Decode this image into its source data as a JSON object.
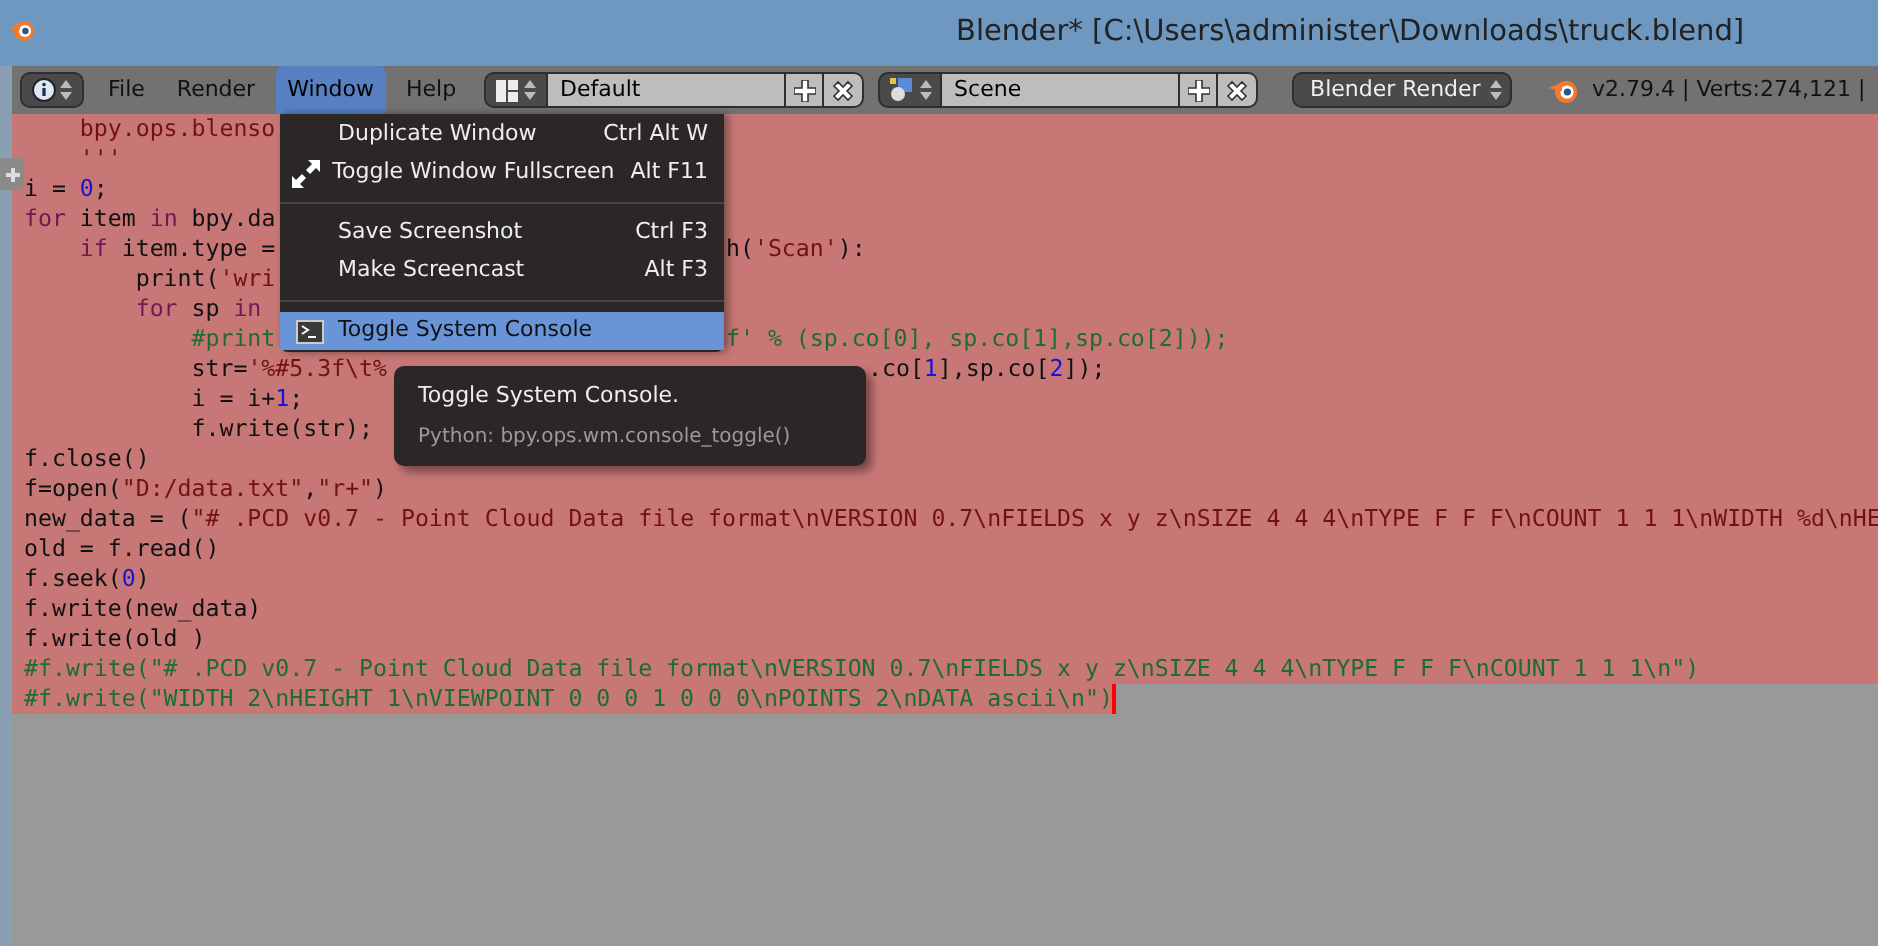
{
  "window": {
    "title": "Blender* [C:\\Users\\administer\\Downloads\\truck.blend]"
  },
  "header": {
    "menus": [
      {
        "label": "File",
        "selected": false
      },
      {
        "label": "Render",
        "selected": false
      },
      {
        "label": "Window",
        "selected": true
      },
      {
        "label": "Help",
        "selected": false
      }
    ],
    "screen_layout": {
      "value": "Default"
    },
    "scene": {
      "value": "Scene"
    },
    "render_engine": {
      "value": "Blender Render"
    },
    "stats": "v2.79.4 | Verts:274,121 |"
  },
  "window_menu": {
    "items": [
      {
        "kind": "item",
        "label": "Duplicate Window",
        "shortcut": "Ctrl Alt W",
        "highlighted": false
      },
      {
        "kind": "fullscreen",
        "label": "Toggle Window Fullscreen",
        "shortcut": "Alt F11",
        "highlighted": false
      },
      {
        "kind": "separator"
      },
      {
        "kind": "item",
        "label": "Save Screenshot",
        "shortcut": "Ctrl F3",
        "highlighted": false
      },
      {
        "kind": "item",
        "label": "Make Screencast",
        "shortcut": "Alt F3",
        "highlighted": false
      },
      {
        "kind": "separator"
      },
      {
        "kind": "console",
        "label": "Toggle System Console",
        "highlighted": true
      }
    ]
  },
  "tooltip": {
    "title": "Toggle System Console.",
    "python": "Python: bpy.ops.wm.console_toggle()"
  },
  "editor": {
    "cursor": true,
    "lines": [
      {
        "tokens": [
          {
            "kind": "string",
            "text": "    bpy.ops.blenso"
          }
        ]
      },
      {
        "tokens": [
          {
            "kind": "string",
            "text": "    '''"
          }
        ]
      },
      {
        "tokens": [
          {
            "kind": "plain",
            "text": "i = "
          },
          {
            "kind": "number",
            "text": "0"
          },
          {
            "kind": "plain",
            "text": ";"
          }
        ]
      },
      {
        "tokens": [
          {
            "kind": "keyword",
            "text": "for"
          },
          {
            "kind": "plain",
            "text": " item "
          },
          {
            "kind": "keyword",
            "text": "in"
          },
          {
            "kind": "plain",
            "text": " bpy.da"
          }
        ]
      },
      {
        "tokens": [
          {
            "kind": "keyword",
            "text": "    if"
          },
          {
            "kind": "plain",
            "text": " item.type ="
          }
        ],
        "tail": {
          "kind": "menu",
          "tokens": [
            {
              "kind": "plain",
              "text": "h("
            },
            {
              "kind": "string",
              "text": "'Scan'"
            },
            {
              "kind": "plain",
              "text": "):"
            }
          ]
        }
      },
      {
        "tokens": [
          {
            "kind": "plain",
            "text": "        print("
          },
          {
            "kind": "string",
            "text": "'wri"
          }
        ]
      },
      {
        "tokens": [
          {
            "kind": "keyword",
            "text": "        for"
          },
          {
            "kind": "plain",
            "text": " sp "
          },
          {
            "kind": "keyword",
            "text": "in"
          }
        ]
      },
      {
        "tokens": [
          {
            "kind": "comment",
            "text": "            #print"
          }
        ],
        "tail": {
          "kind": "menu",
          "tokens": [
            {
              "kind": "comment",
              "text": "f' % (sp.co[0], sp.co[1],sp.co[2]));"
            }
          ]
        }
      },
      {
        "tokens": [
          {
            "kind": "plain",
            "text": "            str="
          },
          {
            "kind": "string",
            "text": "'%#5.3f\\t%"
          }
        ],
        "tail": {
          "kind": "tooltip",
          "tokens": [
            {
              "kind": "plain",
              "text": ".co["
            },
            {
              "kind": "number",
              "text": "1"
            },
            {
              "kind": "plain",
              "text": "],sp.co["
            },
            {
              "kind": "number",
              "text": "2"
            },
            {
              "kind": "plain",
              "text": "]);"
            }
          ]
        }
      },
      {
        "tokens": [
          {
            "kind": "plain",
            "text": "            i = i+"
          },
          {
            "kind": "number",
            "text": "1"
          },
          {
            "kind": "plain",
            "text": ";"
          }
        ]
      },
      {
        "tokens": [
          {
            "kind": "plain",
            "text": "            f.write(str);"
          }
        ]
      },
      {
        "tokens": [
          {
            "kind": "plain",
            "text": "f.close()"
          }
        ]
      },
      {
        "tokens": [
          {
            "kind": "plain",
            "text": "f=open("
          },
          {
            "kind": "string",
            "text": "\"D:/data.txt\""
          },
          {
            "kind": "plain",
            "text": ","
          },
          {
            "kind": "string",
            "text": "\"r+\""
          },
          {
            "kind": "plain",
            "text": ")"
          }
        ]
      },
      {
        "tokens": [
          {
            "kind": "plain",
            "text": "new_data = ("
          },
          {
            "kind": "string",
            "text": "\"# .PCD v0.7 - Point Cloud Data file format\\nVERSION 0.7\\nFIELDS x y z\\nSIZE 4 4 4\\nTYPE F F F\\nCOUNT 1 1 1\\nWIDTH %d\\nHE"
          }
        ]
      },
      {
        "tokens": [
          {
            "kind": "plain",
            "text": "old = f.read()"
          }
        ]
      },
      {
        "tokens": [
          {
            "kind": "plain",
            "text": "f.seek("
          },
          {
            "kind": "number",
            "text": "0"
          },
          {
            "kind": "plain",
            "text": ")"
          }
        ]
      },
      {
        "tokens": [
          {
            "kind": "plain",
            "text": "f.write(new_data)"
          }
        ]
      },
      {
        "tokens": [
          {
            "kind": "plain",
            "text": "f.write(old )"
          }
        ]
      },
      {
        "tokens": [
          {
            "kind": "comment",
            "text": "#f.write(\"# .PCD v0.7 - Point Cloud Data file format\\nVERSION 0.7\\nFIELDS x y z\\nSIZE 4 4 4\\nTYPE F F F\\nCOUNT 1 1 1\\n\")"
          }
        ]
      },
      {
        "tokens": [
          {
            "kind": "comment",
            "text": "#f.write(\"WIDTH 2\\nHEIGHT 1\\nVIEWPOINT 0 0 0 1 0 0 0\\nPOINTS 2\\nDATA ascii\\n\")"
          }
        ]
      }
    ]
  }
}
